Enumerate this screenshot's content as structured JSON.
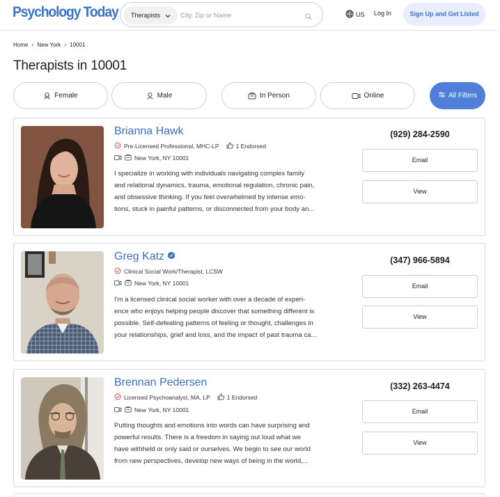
{
  "header": {
    "logo": "Psychology Today",
    "search_type": "Therapists",
    "search_placeholder": "City, Zip or Name",
    "locale": "US",
    "login_label": "Log In",
    "signup_label": "Sign Up and Get Listed"
  },
  "breadcrumb": [
    "Home",
    "New York",
    "10001"
  ],
  "page_title": "Therapists in 10001",
  "filters": [
    {
      "label": "Female",
      "icon": "female-icon"
    },
    {
      "label": "Male",
      "icon": "male-icon"
    },
    {
      "label": "In Person",
      "icon": "in-person-icon"
    },
    {
      "label": "Online",
      "icon": "video-icon"
    },
    {
      "label": "All Filters",
      "icon": "sliders-icon"
    }
  ],
  "therapists": [
    {
      "name": "Brianna Hawk",
      "verified": false,
      "credentials": "Pre-Licensed Professional, MHC-LP",
      "endorsed": "1 Endorsed",
      "location": "New York, NY 10001",
      "bio_lines": [
        "I specialize in working with individuals navigating complex family",
        "and relational dynamics, trauma, emotional regulation, chronic pain,",
        "and obsessive thinking. If you feel overwhelmed by intense emo-",
        "tions, stuck in painful patterns, or disconnected from your body an..."
      ],
      "phone": "(929) 284-2590",
      "email_label": "Email",
      "view_label": "View"
    },
    {
      "name": "Greg Katz",
      "verified": true,
      "credentials": "Clinical Social Work/Therapist, LCSW",
      "endorsed": "",
      "location": "New York, NY 10001",
      "bio_lines": [
        "I'm a licensed clinical social worker with over a decade of experi-",
        "ence who enjoys helping people discover that something different is",
        "possible. Self-defeating patterns of feeling or thought, challenges in",
        "your relationships, grief and loss, and the impact of past trauma ca..."
      ],
      "phone": "(347) 966-5894",
      "email_label": "Email",
      "view_label": "View"
    },
    {
      "name": "Brennan Pedersen",
      "verified": false,
      "credentials": "Licensed Psychoanalyst, MA, LP",
      "endorsed": "1 Endorsed",
      "location": "New York, NY 10001",
      "bio_lines": [
        "Putting thoughts and emotions into words can have surprising and",
        "powerful results. There is a freedom in saying out loud what we",
        "have withheld or only said or ourselves. We begin to see our world",
        "from new perspectives, develop new ways of being in the world,..."
      ],
      "phone": "(332) 263-4474",
      "email_label": "Email",
      "view_label": "View"
    }
  ],
  "colors": {
    "brand_blue": "#3b73c9",
    "primary_button": "#4f7fd8",
    "signup_bg": "#e8eefb",
    "credential_check": "#d0454c"
  }
}
